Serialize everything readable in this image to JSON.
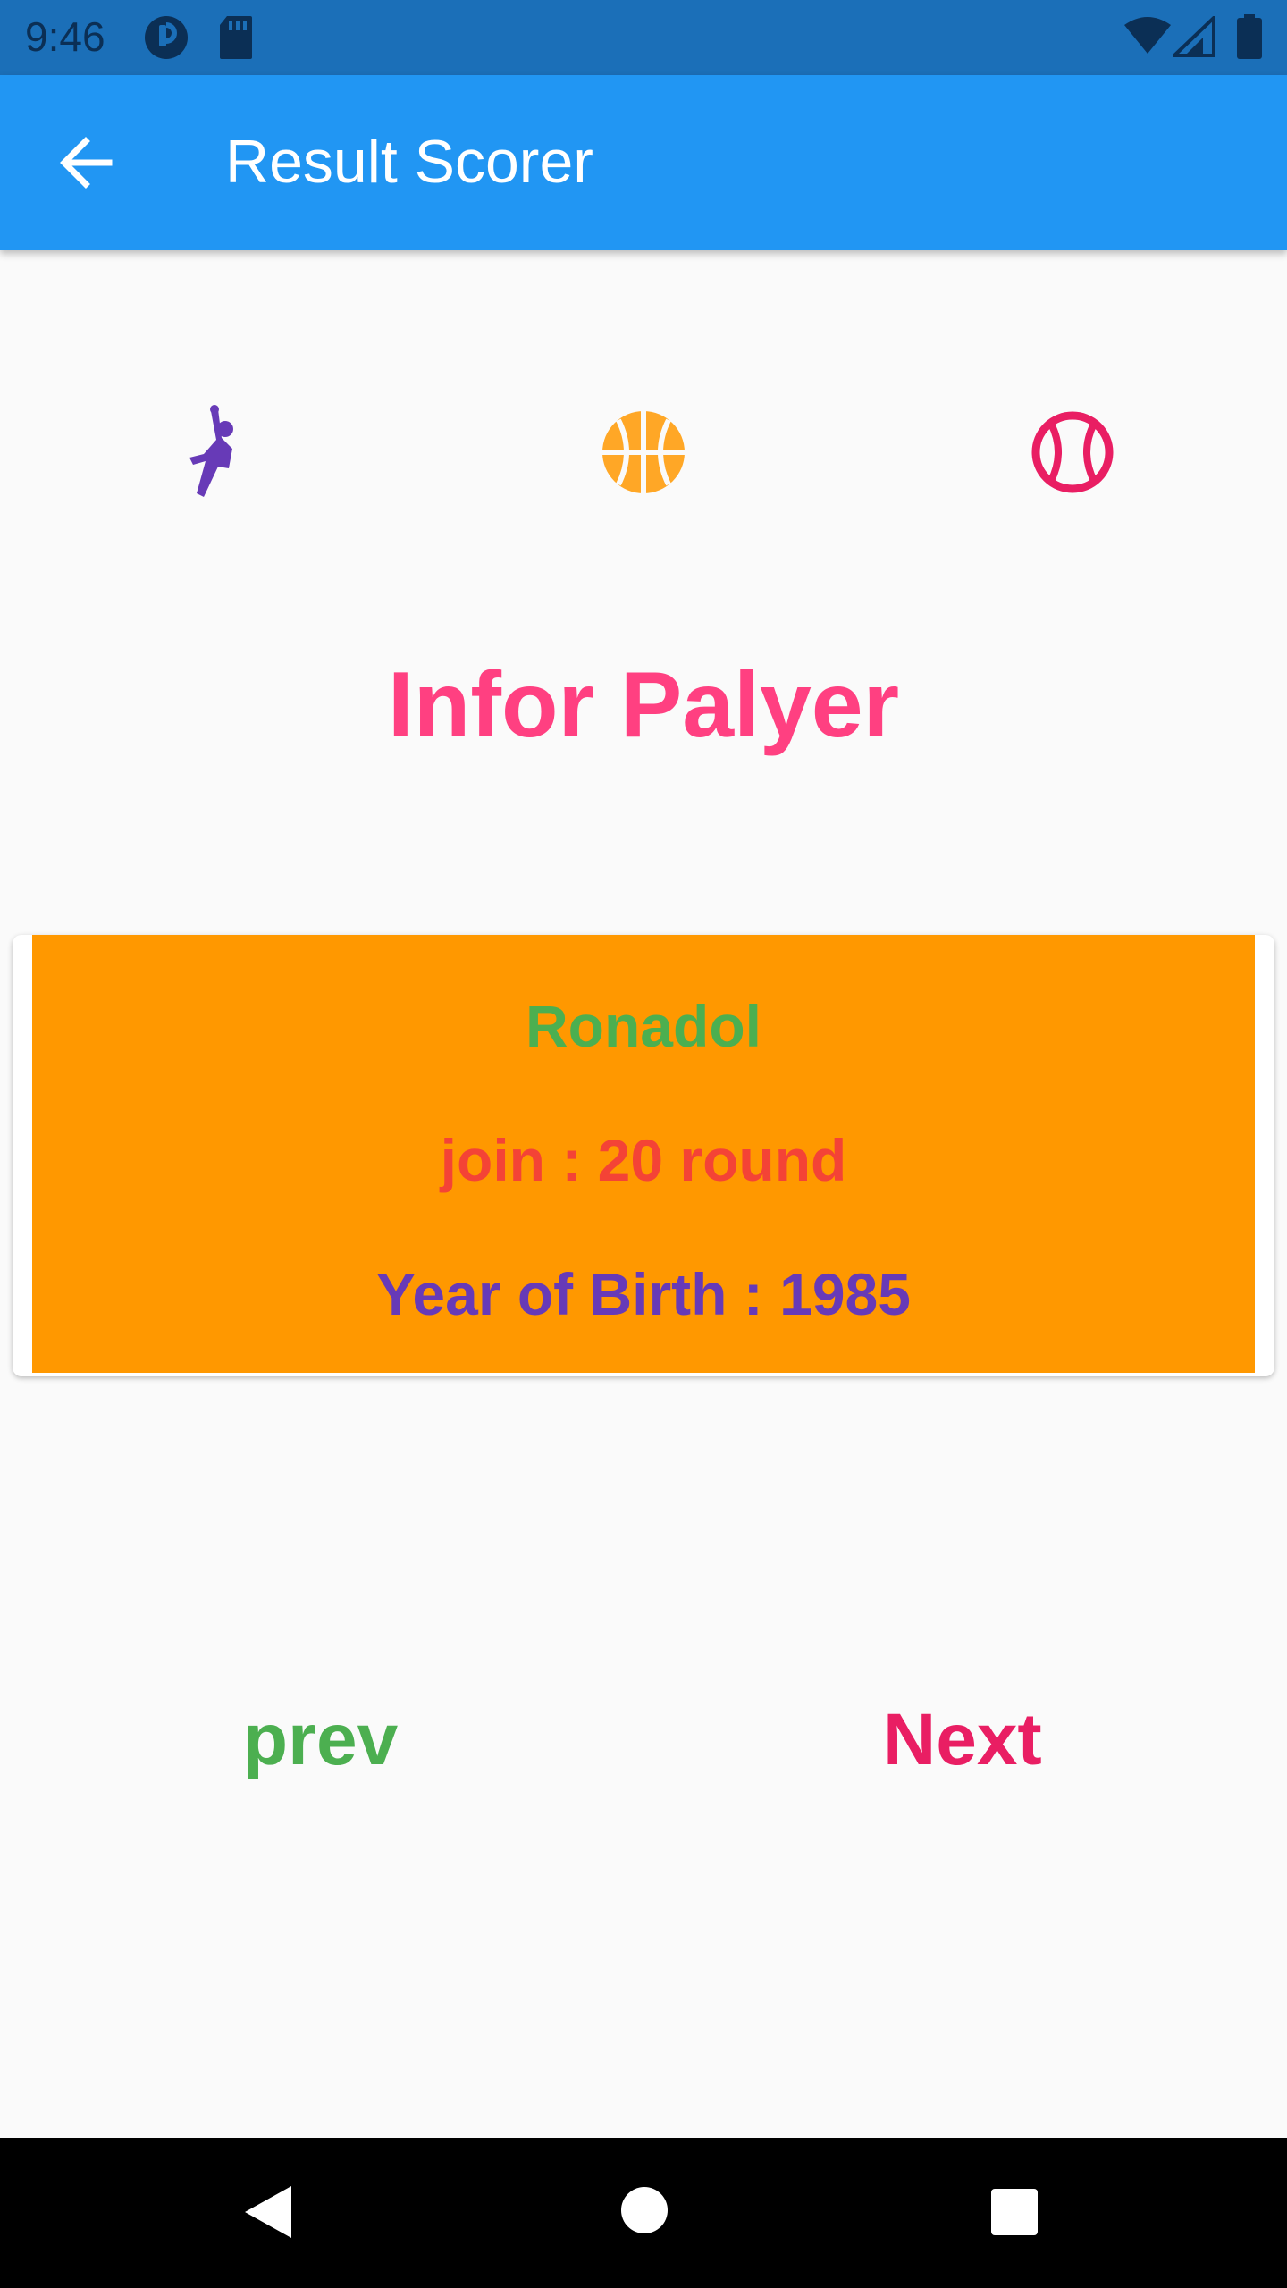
{
  "status_bar": {
    "time": "9:46",
    "icons": [
      "app-notification-icon",
      "sd-card-icon",
      "wifi-icon",
      "signal-icon",
      "battery-icon"
    ]
  },
  "app_bar": {
    "title": "Result Scorer",
    "back_icon": "arrow-back-icon",
    "color": "#2196f3"
  },
  "sport_icons": [
    {
      "name": "volleyball-player-icon",
      "color": "#673ab7"
    },
    {
      "name": "basketball-icon",
      "color": "#ffa726"
    },
    {
      "name": "baseball-icon",
      "color": "#e91e63"
    }
  ],
  "main": {
    "heading": "Infor Palyer",
    "heading_color": "#ff4081"
  },
  "player_card": {
    "background": "#ff9800",
    "name": "Ronadol",
    "name_color": "#4caf50",
    "join": "join : 20 round",
    "join_color": "#f44336",
    "birth": "Year of Birth : 1985",
    "birth_color": "#673ab7"
  },
  "navigation": {
    "prev_label": "prev",
    "prev_color": "#4caf50",
    "next_label": "Next",
    "next_color": "#e91e63"
  },
  "system_nav": [
    "back-triangle-icon",
    "home-circle-icon",
    "recents-square-icon"
  ]
}
